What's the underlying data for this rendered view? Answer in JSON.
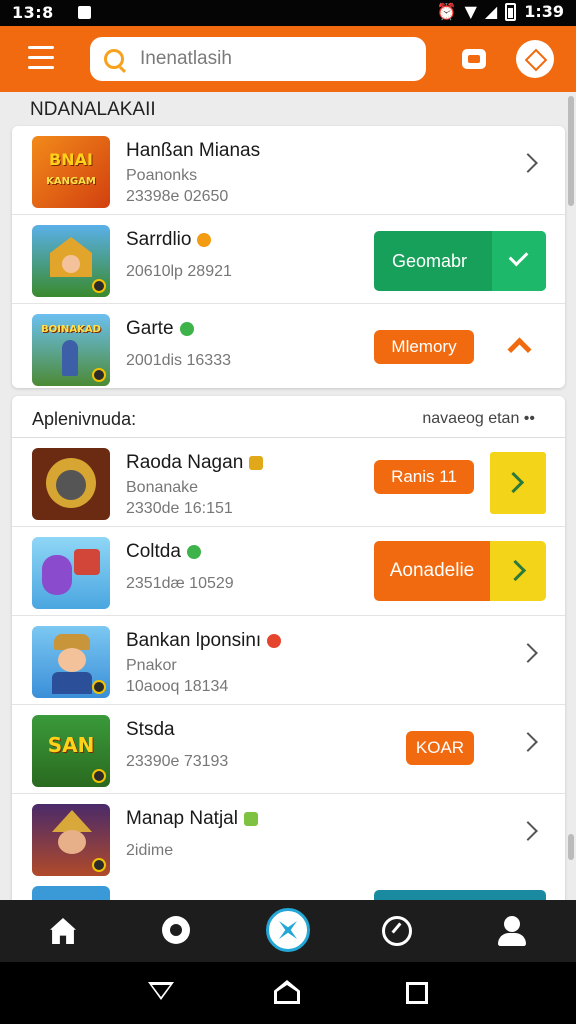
{
  "status_bar": {
    "left_time": "13:8",
    "right_time": "1:39"
  },
  "search": {
    "placeholder": "Inenatlasih"
  },
  "section_header": "NDANALAKAII",
  "featured": [
    {
      "title": "Hanßan Mianas",
      "line1": "Poanonks",
      "line2": "23398e 02650",
      "action": "chevron"
    },
    {
      "title": "Sarrdlio",
      "title_badge": "orange",
      "line2": "20610lp 28921",
      "action_label": "Geomabr"
    },
    {
      "title": "Garte",
      "title_badge": "green",
      "line2": "2001dis 16333",
      "action_label": "Mlemory"
    }
  ],
  "list_section": {
    "left": "Aplenivnuda:",
    "right": "navaeog etan  ••"
  },
  "apps": [
    {
      "title": "Raoda Nagan",
      "title_badge": "gold",
      "line1": "Bonanake",
      "line2": "2330de 16:151",
      "action_label": "Ranis 11"
    },
    {
      "title": "Coltda",
      "title_badge": "green",
      "line2": "2351dæ 10529",
      "action_label": "Aonadelie"
    },
    {
      "title": "Bankan lponsinı",
      "title_badge": "red",
      "line1": "Pnakor",
      "line2": "10aooq 18134"
    },
    {
      "title": "Stsda",
      "line2": "23390e 73193",
      "action_label": "KOAR"
    },
    {
      "title": "Manap Natjal",
      "title_badge": "lime",
      "line2": "2idime"
    }
  ],
  "thumb_text": {
    "t1": "BNAI",
    "t1b": "KANGAM",
    "t3": "BOINAKAD",
    "t6": "SAN"
  },
  "colors": {
    "accent": "#f26a10",
    "primary_green": "#17a05a",
    "yellow": "#f4d418",
    "nav_bg": "#1d1d1d"
  },
  "icons": [
    "menu-icon",
    "search-icon",
    "bag-icon",
    "compass-icon",
    "home-icon",
    "explore-icon",
    "center-star-icon",
    "timer-icon",
    "user-icon",
    "back-icon",
    "home-nav-icon",
    "recent-icon"
  ]
}
